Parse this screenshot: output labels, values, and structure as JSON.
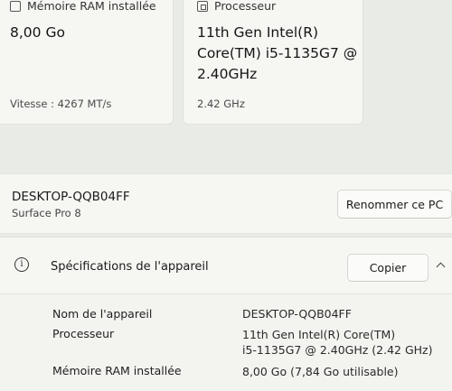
{
  "cards": {
    "ram": {
      "title": "Mémoire RAM installée",
      "value": "8,00 Go",
      "sub": "Vitesse : 4267 MT/s"
    },
    "cpu": {
      "title": "Processeur",
      "value_line1": "11th Gen Intel(R)",
      "value_line2": "Core(TM) i5-1135G7 @",
      "value_line3": "2.40GHz",
      "sub": "2.42 GHz"
    }
  },
  "device": {
    "name": "DESKTOP-QQB04FF",
    "model": "Surface Pro 8",
    "rename_label": "Renommer ce PC"
  },
  "specs": {
    "title": "Spécifications de l'appareil",
    "copy_label": "Copier",
    "info_icon": "info-icon",
    "collapse_icon": "chevron-up-icon",
    "rows": [
      {
        "label": "Nom de l'appareil",
        "value": "DESKTOP-QQB04FF"
      },
      {
        "label": "Processeur",
        "value_line1": "11th Gen Intel(R) Core(TM)",
        "value_line2": "i5-1135G7 @ 2.40GHz (2.42 GHz)"
      },
      {
        "label": "Mémoire RAM installée",
        "value": "8,00 Go (7,84 Go utilisable)"
      }
    ]
  }
}
